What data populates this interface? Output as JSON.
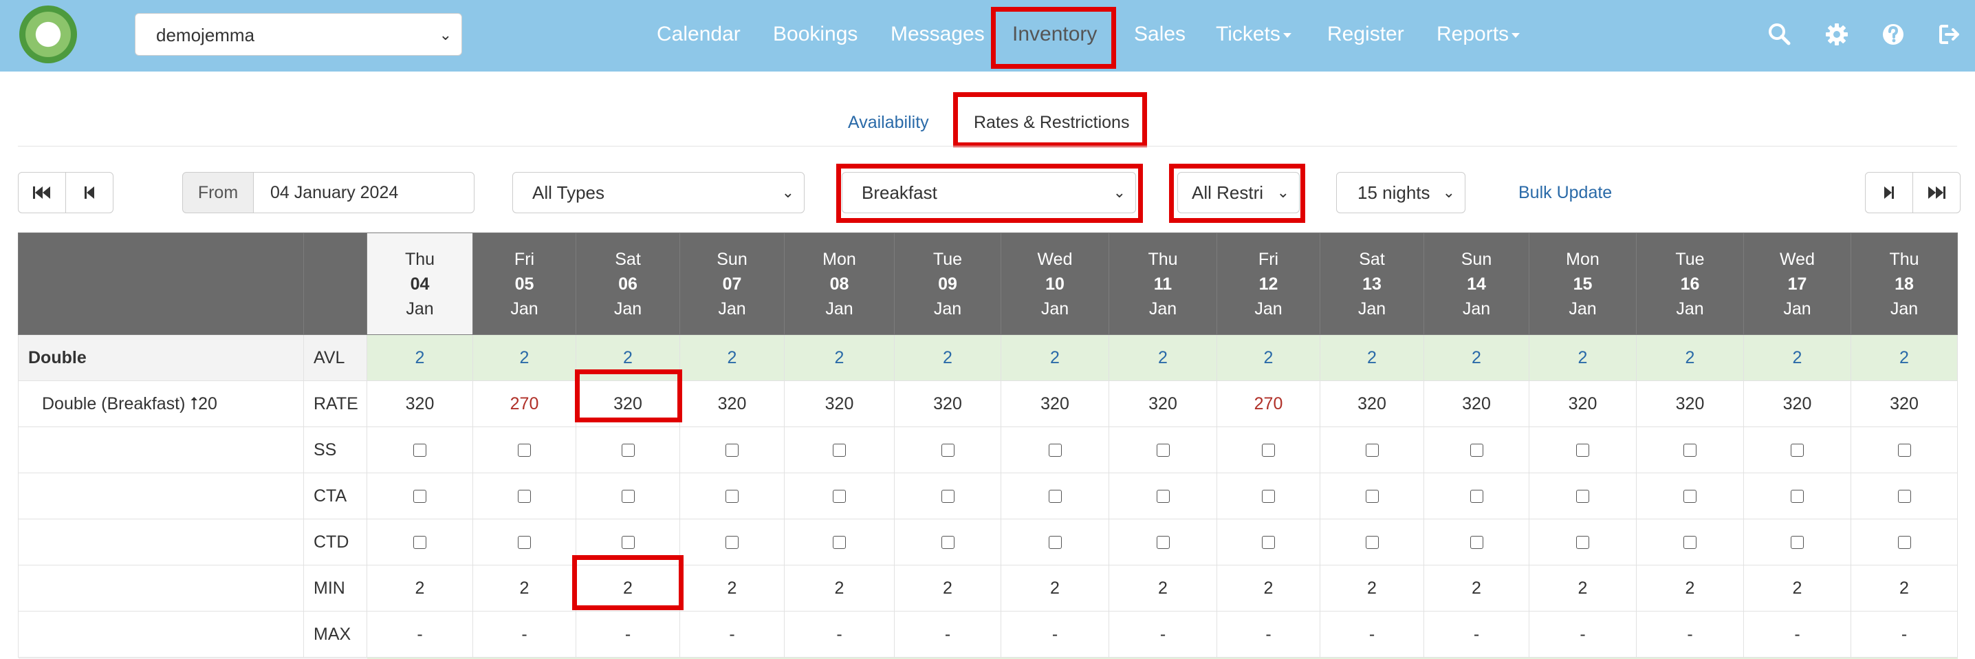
{
  "nav": {
    "property": "demojemma",
    "items": [
      {
        "label": "Calendar"
      },
      {
        "label": "Bookings"
      },
      {
        "label": "Messages"
      },
      {
        "label": "Inventory"
      },
      {
        "label": "Sales"
      },
      {
        "label": "Tickets"
      },
      {
        "label": "Register"
      },
      {
        "label": "Reports"
      }
    ],
    "active": "Inventory"
  },
  "subtabs": {
    "availability": "Availability",
    "rates": "Rates & Restrictions"
  },
  "controls": {
    "from_label": "From",
    "from_value": "04 January 2024",
    "types": "All Types",
    "rate_plan": "Breakfast",
    "restrictions": "All Restri",
    "nights": "15 nights",
    "bulk_update": "Bulk Update"
  },
  "colors": {
    "navbar": "#8ec7e8",
    "highlight": "#e00000",
    "link": "#2a6aa8",
    "availability_bg": "#e3f1dc",
    "lower_rate": "#b03028"
  },
  "grid": {
    "dates": [
      {
        "dow": "Thu",
        "day": "04",
        "mon": "Jan"
      },
      {
        "dow": "Fri",
        "day": "05",
        "mon": "Jan"
      },
      {
        "dow": "Sat",
        "day": "06",
        "mon": "Jan"
      },
      {
        "dow": "Sun",
        "day": "07",
        "mon": "Jan"
      },
      {
        "dow": "Mon",
        "day": "08",
        "mon": "Jan"
      },
      {
        "dow": "Tue",
        "day": "09",
        "mon": "Jan"
      },
      {
        "dow": "Wed",
        "day": "10",
        "mon": "Jan"
      },
      {
        "dow": "Thu",
        "day": "11",
        "mon": "Jan"
      },
      {
        "dow": "Fri",
        "day": "12",
        "mon": "Jan"
      },
      {
        "dow": "Sat",
        "day": "13",
        "mon": "Jan"
      },
      {
        "dow": "Sun",
        "day": "14",
        "mon": "Jan"
      },
      {
        "dow": "Mon",
        "day": "15",
        "mon": "Jan"
      },
      {
        "dow": "Tue",
        "day": "16",
        "mon": "Jan"
      },
      {
        "dow": "Wed",
        "day": "17",
        "mon": "Jan"
      },
      {
        "dow": "Thu",
        "day": "18",
        "mon": "Jan"
      }
    ],
    "room": "Double",
    "rate_name": "Double (Breakfast) ⭡20",
    "rows": {
      "avl": {
        "code": "AVL",
        "values": [
          "2",
          "2",
          "2",
          "2",
          "2",
          "2",
          "2",
          "2",
          "2",
          "2",
          "2",
          "2",
          "2",
          "2",
          "2"
        ]
      },
      "rate": {
        "code": "RATE",
        "values": [
          "320",
          "270",
          "320",
          "320",
          "320",
          "320",
          "320",
          "320",
          "270",
          "320",
          "320",
          "320",
          "320",
          "320",
          "320"
        ]
      },
      "ss": {
        "code": "SS",
        "checked": [
          false,
          false,
          false,
          false,
          false,
          false,
          false,
          false,
          false,
          false,
          false,
          false,
          false,
          false,
          false
        ]
      },
      "cta": {
        "code": "CTA",
        "checked": [
          false,
          false,
          false,
          false,
          false,
          false,
          false,
          false,
          false,
          false,
          false,
          false,
          false,
          false,
          false
        ]
      },
      "ctd": {
        "code": "CTD",
        "checked": [
          false,
          false,
          false,
          false,
          false,
          false,
          false,
          false,
          false,
          false,
          false,
          false,
          false,
          false,
          false
        ]
      },
      "min": {
        "code": "MIN",
        "values": [
          "2",
          "2",
          "2",
          "2",
          "2",
          "2",
          "2",
          "2",
          "2",
          "2",
          "2",
          "2",
          "2",
          "2",
          "2"
        ]
      },
      "max": {
        "code": "MAX",
        "values": [
          "-",
          "-",
          "-",
          "-",
          "-",
          "-",
          "-",
          "-",
          "-",
          "-",
          "-",
          "-",
          "-",
          "-",
          "-"
        ]
      }
    }
  }
}
